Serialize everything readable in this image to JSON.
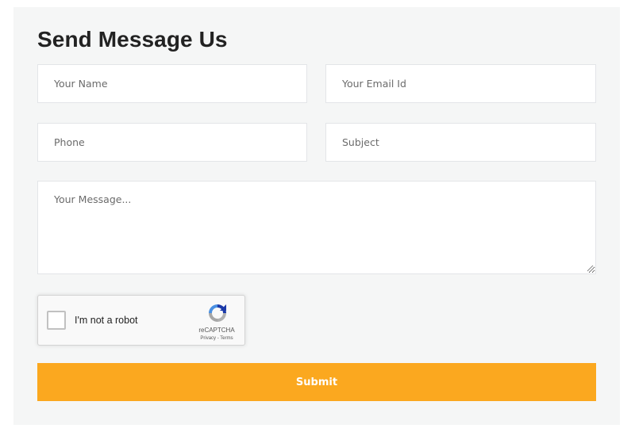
{
  "form": {
    "title": "Send Message Us",
    "name_placeholder": "Your Name",
    "email_placeholder": "Your Email Id",
    "phone_placeholder": "Phone",
    "subject_placeholder": "Subject",
    "message_placeholder": "Your Message...",
    "submit_label": "Submit"
  },
  "recaptcha": {
    "label": "I'm not a robot",
    "brand": "reCAPTCHA",
    "privacy": "Privacy",
    "separator": " - ",
    "terms": "Terms",
    "checked": false,
    "icon": "recaptcha-logo-icon"
  },
  "colors": {
    "submit_bg": "#fba81f",
    "panel_bg": "#f5f6f6",
    "title": "#222222"
  }
}
